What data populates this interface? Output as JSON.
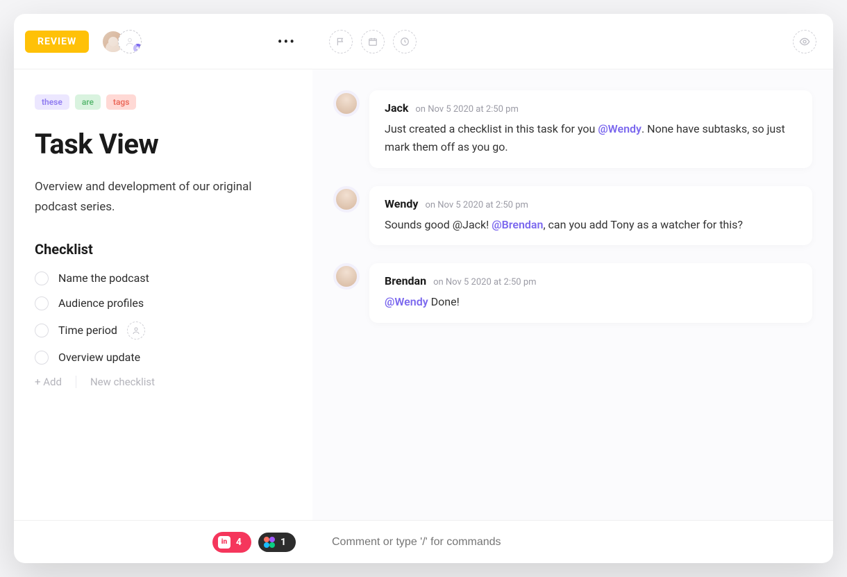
{
  "header": {
    "status_label": "REVIEW"
  },
  "tags": [
    "these",
    "are",
    "tags"
  ],
  "task": {
    "title": "Task View",
    "description": "Overview and development of our original podcast series.",
    "checklist_title": "Checklist",
    "checklist": [
      {
        "label": "Name the podcast",
        "assignable": false
      },
      {
        "label": "Audience profiles",
        "assignable": false
      },
      {
        "label": "Time period",
        "assignable": true
      },
      {
        "label": "Overview update",
        "assignable": false
      }
    ],
    "add_label": "+ Add",
    "new_checklist_label": "New checklist"
  },
  "comments": [
    {
      "author": "Jack",
      "timestamp": "on Nov 5 2020 at 2:50 pm",
      "segments": [
        {
          "text": "Just created a checklist in this task for you "
        },
        {
          "text": "@Wendy",
          "mention": true
        },
        {
          "text": ". None have subtasks, so just mark them off as you go."
        }
      ]
    },
    {
      "author": "Wendy",
      "timestamp": "on Nov 5 2020 at 2:50 pm",
      "segments": [
        {
          "text": "Sounds good @Jack! "
        },
        {
          "text": "@Brendan",
          "mention": true
        },
        {
          "text": ", can you add Tony as a watcher for this?"
        }
      ]
    },
    {
      "author": "Brendan",
      "timestamp": "on Nov 5 2020 at 2:50 pm",
      "segments": [
        {
          "text": "@Wendy",
          "mention": true
        },
        {
          "text": " Done!"
        }
      ]
    }
  ],
  "attachments": {
    "invision_count": "4",
    "figma_count": "1"
  },
  "composer": {
    "placeholder": "Comment or type '/' for commands"
  }
}
